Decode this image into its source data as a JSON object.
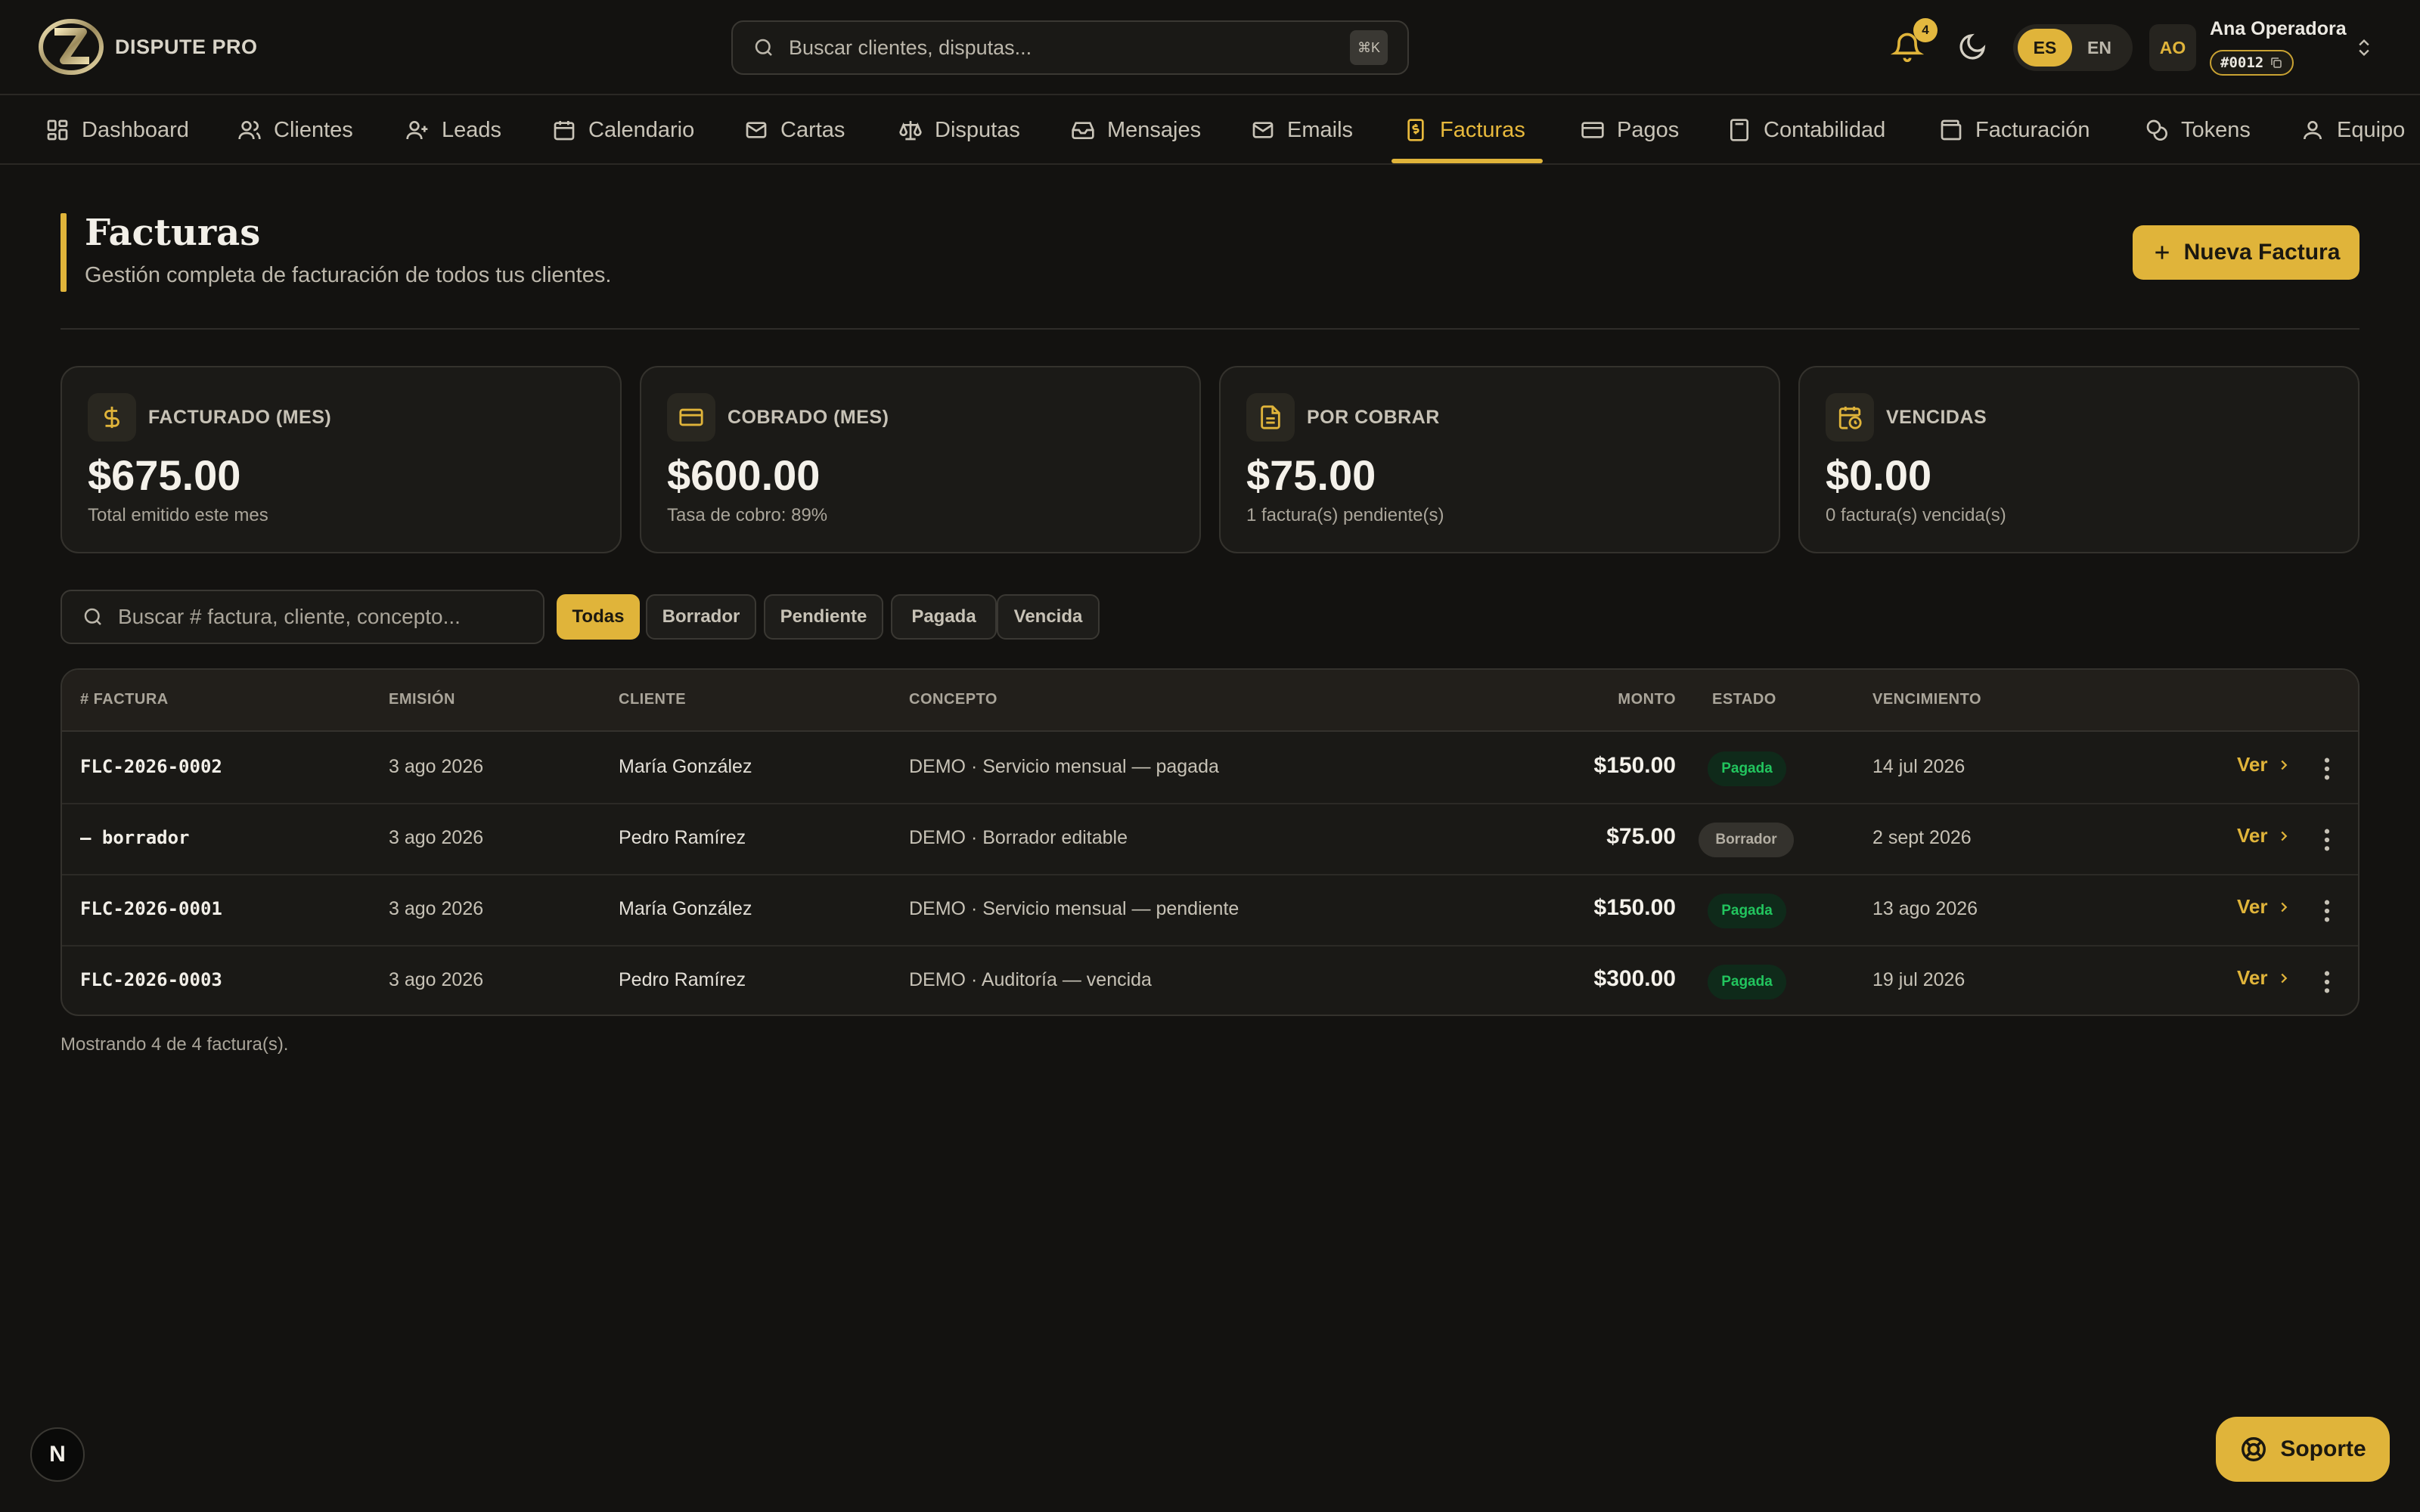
{
  "app": {
    "name": "DISPUTE PRO"
  },
  "search": {
    "placeholder": "Buscar clientes, disputas...",
    "shortcut": "⌘K"
  },
  "notifications": {
    "count": "4"
  },
  "language": {
    "options": [
      "ES",
      "EN"
    ],
    "active": "ES"
  },
  "user": {
    "initials": "AO",
    "name": "Ana Operadora",
    "id": "#0012"
  },
  "nav": [
    {
      "label": "Dashboard",
      "icon": "layout-grid-icon"
    },
    {
      "label": "Clientes",
      "icon": "users-icon"
    },
    {
      "label": "Leads",
      "icon": "user-plus-icon"
    },
    {
      "label": "Calendario",
      "icon": "calendar-icon"
    },
    {
      "label": "Cartas",
      "icon": "mail-icon"
    },
    {
      "label": "Disputas",
      "icon": "scale-icon"
    },
    {
      "label": "Mensajes",
      "icon": "inbox-icon"
    },
    {
      "label": "Emails",
      "icon": "envelope-icon"
    },
    {
      "label": "Facturas",
      "icon": "receipt-dollar-icon",
      "active": true
    },
    {
      "label": "Pagos",
      "icon": "credit-card-icon"
    },
    {
      "label": "Contabilidad",
      "icon": "calculator-icon"
    },
    {
      "label": "Facturación",
      "icon": "wallet-icon"
    },
    {
      "label": "Tokens",
      "icon": "coins-icon"
    },
    {
      "label": "Equipo",
      "icon": "user-icon"
    }
  ],
  "page": {
    "title": "Facturas",
    "subtitle": "Gestión completa de facturación de todos tus clientes.",
    "new_button": "Nueva Factura"
  },
  "stats": [
    {
      "label": "FACTURADO (MES)",
      "value": "$675.00",
      "sub": "Total emitido este mes",
      "icon": "dollar-icon"
    },
    {
      "label": "COBRADO (MES)",
      "value": "$600.00",
      "sub": "Tasa de cobro: 89%",
      "icon": "credit-card-icon"
    },
    {
      "label": "POR COBRAR",
      "value": "$75.00",
      "sub": "1 factura(s) pendiente(s)",
      "icon": "document-icon"
    },
    {
      "label": "VENCIDAS",
      "value": "$0.00",
      "sub": "0 factura(s) vencida(s)",
      "icon": "calendar-clock-icon"
    }
  ],
  "table_search": {
    "placeholder": "Buscar # factura, cliente, concepto..."
  },
  "filters": [
    "Todas",
    "Borrador",
    "Pendiente",
    "Pagada",
    "Vencida"
  ],
  "active_filter": "Todas",
  "table": {
    "columns": [
      "# FACTURA",
      "EMISIÓN",
      "CLIENTE",
      "CONCEPTO",
      "MONTO",
      "ESTADO",
      "VENCIMIENTO"
    ],
    "rows": [
      {
        "number": "FLC-2026-0002",
        "issued": "3 ago 2026",
        "client": "María González",
        "concept": "DEMO · Servicio mensual — pagada",
        "amount": "$150.00",
        "status": "Pagada",
        "due": "14 jul 2026",
        "action": "Ver"
      },
      {
        "number": "— borrador",
        "issued": "3 ago 2026",
        "client": "Pedro Ramírez",
        "concept": "DEMO · Borrador editable",
        "amount": "$75.00",
        "status": "Borrador",
        "due": "2 sept 2026",
        "action": "Ver"
      },
      {
        "number": "FLC-2026-0001",
        "issued": "3 ago 2026",
        "client": "María González",
        "concept": "DEMO · Servicio mensual — pendiente",
        "amount": "$150.00",
        "status": "Pagada",
        "due": "13 ago 2026",
        "action": "Ver"
      },
      {
        "number": "FLC-2026-0003",
        "issued": "3 ago 2026",
        "client": "Pedro Ramírez",
        "concept": "DEMO · Auditoría — vencida",
        "amount": "$300.00",
        "status": "Pagada",
        "due": "19 jul 2026",
        "action": "Ver"
      }
    ]
  },
  "footer": {
    "showing": "Mostrando 4 de 4 factura(s)."
  },
  "floating": {
    "n_badge": "N",
    "support": "Soporte"
  },
  "colors": {
    "accent": "#e0b43a",
    "background": "#131210",
    "paid": "#22c55e"
  }
}
